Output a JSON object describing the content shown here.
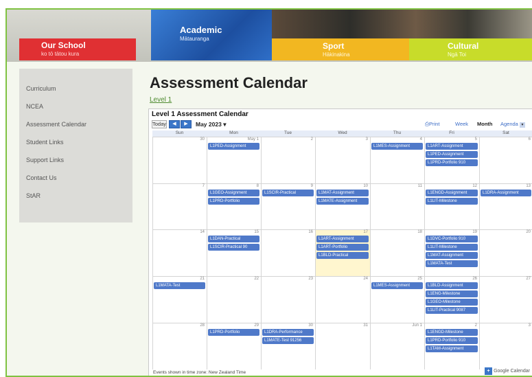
{
  "banner": {
    "our_school": "Our School",
    "our_school_sub": "ko tō tātou kura",
    "academic": "Academic",
    "academic_sub": "Mātauranga",
    "sport": "Sport",
    "sport_sub": "Hākinakina",
    "cultural": "Cultural",
    "cultural_sub": "Ngā Toi"
  },
  "sidebar": {
    "items": [
      "Curriculum",
      "NCEA",
      "Assessment Calendar",
      "Student Links",
      "Support Links",
      "Contact Us",
      "StAR"
    ]
  },
  "page": {
    "title": "Assessment Calendar",
    "level_link": "Level 1"
  },
  "calendar": {
    "title": "Level 1 Assessment Calendar",
    "today_btn": "Today",
    "prev": "◀",
    "next": "▶",
    "month": "May 2023",
    "print": "Print",
    "views": [
      "Week",
      "Month",
      "Agenda"
    ],
    "days": [
      "Sun",
      "Mon",
      "Tue",
      "Wed",
      "Thu",
      "Fri",
      "Sat"
    ],
    "weeks": [
      {
        "dates": [
          "30",
          "May 1",
          "2",
          "3",
          "4",
          "5",
          "6"
        ]
      },
      {
        "dates": [
          "7",
          "8",
          "9",
          "10",
          "11",
          "12",
          "13"
        ]
      },
      {
        "dates": [
          "14",
          "15",
          "16",
          "17",
          "18",
          "19",
          "20"
        ]
      },
      {
        "dates": [
          "21",
          "22",
          "23",
          "24",
          "25",
          "26",
          "27"
        ]
      },
      {
        "dates": [
          "28",
          "29",
          "30",
          "31",
          "Jun 1",
          "2",
          "3"
        ]
      }
    ],
    "events": [
      {
        "week": 0,
        "day": 1,
        "slot": 0,
        "label": "L1PED-Assignment"
      },
      {
        "week": 0,
        "day": 4,
        "slot": 0,
        "label": "L1MES-Assignment"
      },
      {
        "week": 0,
        "day": 5,
        "slot": 0,
        "label": "L1ART-Assignment"
      },
      {
        "week": 0,
        "day": 5,
        "slot": 1,
        "label": "L1PED-Assignment"
      },
      {
        "week": 0,
        "day": 5,
        "slot": 2,
        "label": "L1PRD-Portfolio 910"
      },
      {
        "week": 1,
        "day": 1,
        "slot": 0,
        "label": "L1GEO-Assignment"
      },
      {
        "week": 1,
        "day": 1,
        "slot": 1,
        "label": "L1PRD-Portfolio"
      },
      {
        "week": 1,
        "day": 2,
        "slot": 0,
        "label": "L1SCIR-Practical"
      },
      {
        "week": 1,
        "day": 3,
        "slot": 0,
        "label": "L1MAT-Assignment"
      },
      {
        "week": 1,
        "day": 3,
        "slot": 1,
        "label": "L1MATE-Assignment"
      },
      {
        "week": 1,
        "day": 5,
        "slot": 0,
        "label": "L1ENGD-Assignment"
      },
      {
        "week": 1,
        "day": 5,
        "slot": 1,
        "label": "L1LIT-Milestone"
      },
      {
        "week": 1,
        "day": 6,
        "slot": 0,
        "label": "L1DRA-Assignment"
      },
      {
        "week": 2,
        "day": 1,
        "slot": 0,
        "label": "L1DAN-Practical"
      },
      {
        "week": 2,
        "day": 1,
        "slot": 1,
        "label": "L1SCIR-Practical 90"
      },
      {
        "week": 2,
        "day": 3,
        "slot": 0,
        "label": "L1ART-Assignment"
      },
      {
        "week": 2,
        "day": 3,
        "slot": 1,
        "label": "L1ART-Portfolio"
      },
      {
        "week": 2,
        "day": 3,
        "slot": 2,
        "label": "L1BLD-Practical"
      },
      {
        "week": 2,
        "day": 5,
        "slot": 0,
        "label": "L1DVC-Portfolio 910"
      },
      {
        "week": 2,
        "day": 5,
        "slot": 1,
        "label": "L1LIT-Milestone"
      },
      {
        "week": 2,
        "day": 5,
        "slot": 2,
        "label": "L1MAT-Assignment"
      },
      {
        "week": 2,
        "day": 5,
        "slot": 3,
        "label": "L1MATA-Test"
      },
      {
        "week": 3,
        "day": 0,
        "slot": 0,
        "label": "L1MATA-Test"
      },
      {
        "week": 3,
        "day": 4,
        "slot": 0,
        "label": "L1MES-Assignment"
      },
      {
        "week": 3,
        "day": 5,
        "slot": 0,
        "label": "L1BLD-Assignment"
      },
      {
        "week": 3,
        "day": 5,
        "slot": 1,
        "label": "L1ENG-Milestone"
      },
      {
        "week": 3,
        "day": 5,
        "slot": 2,
        "label": "L1GEO-Milestone"
      },
      {
        "week": 3,
        "day": 5,
        "slot": 3,
        "label": "L1LIT-Practical 9087"
      },
      {
        "week": 4,
        "day": 1,
        "slot": 0,
        "label": "L1PRD-Portfolio"
      },
      {
        "week": 4,
        "day": 2,
        "slot": 0,
        "label": "L1DRA-Performance"
      },
      {
        "week": 4,
        "day": 2,
        "slot": 1,
        "label": "L1MATE-Test 91256"
      },
      {
        "week": 4,
        "day": 5,
        "slot": 0,
        "label": "L1ENGD-Milestone"
      },
      {
        "week": 4,
        "day": 5,
        "slot": 1,
        "label": "L1PRD-Portfolio 910"
      },
      {
        "week": 4,
        "day": 5,
        "slot": 2,
        "label": "L1TAM-Assignment"
      }
    ],
    "timezone_note": "Events shown in time zone: New Zealand Time",
    "google_calendar": "Google Calendar"
  }
}
